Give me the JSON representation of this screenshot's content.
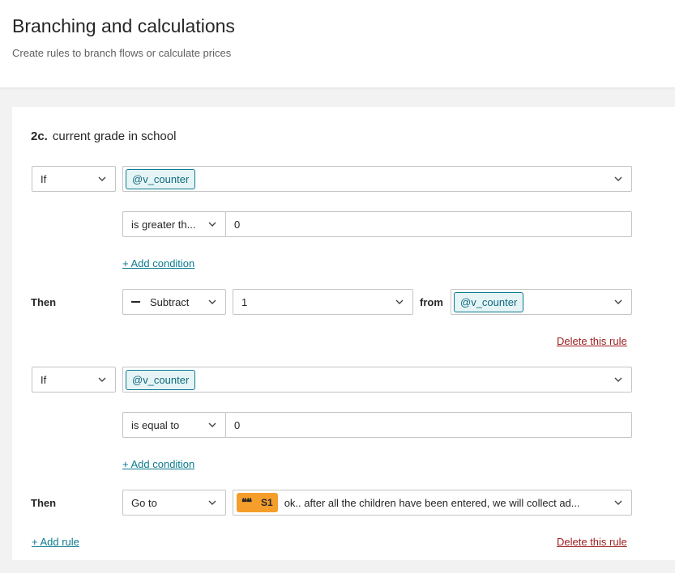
{
  "header": {
    "title": "Branching and calculations",
    "subtitle": "Create rules to branch flows or calculate prices"
  },
  "question": {
    "number": "2c.",
    "text": "current grade in school"
  },
  "rules": [
    {
      "if_label": "If",
      "variable": "@v_counter",
      "operator": "is greater th...",
      "value": "0",
      "add_condition": "+ Add condition",
      "then_label": "Then",
      "action": "Subtract",
      "action_icon": "minus-icon",
      "amount": "1",
      "from_label": "from",
      "target_variable": "@v_counter",
      "delete": "Delete this rule"
    },
    {
      "if_label": "If",
      "variable": "@v_counter",
      "operator": "is equal to",
      "value": "0",
      "add_condition": "+ Add condition",
      "then_label": "Then",
      "action": "Go to",
      "destination_badge": "S1",
      "destination_icon": "quote-icon",
      "destination_text": "ok.. after all the children have been entered, we will collect ad...",
      "delete": "Delete this rule"
    }
  ],
  "add_rule": "+ Add rule",
  "colors": {
    "accent": "#0b7a8f",
    "delete": "#9b1c1c",
    "badge": "#f59e2b"
  }
}
